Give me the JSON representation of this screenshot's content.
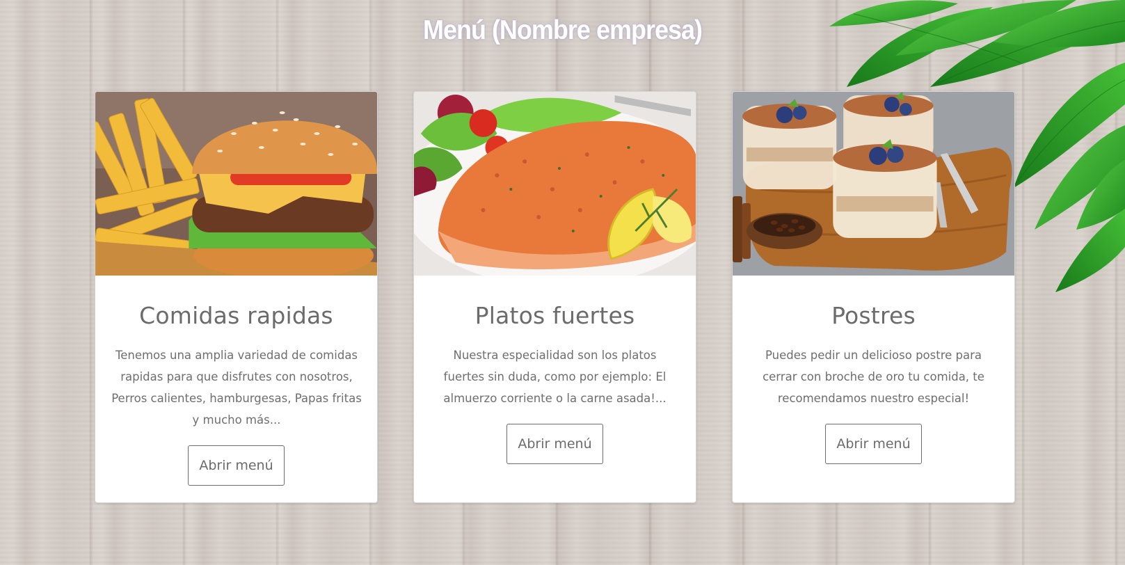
{
  "header": {
    "title": "Menú (Nombre empresa)"
  },
  "cards": [
    {
      "image_alt": "hamburger-and-fries",
      "title": "Comidas rapidas",
      "text": "Tenemos una amplia variedad de comidas rapidas para que disfrutes con nosotros, Perros calientes, hamburgesas, Papas fritas y mucho más...",
      "button_label": "Abrir menú"
    },
    {
      "image_alt": "salmon-fillet-with-salad",
      "title": "Platos fuertes",
      "text": "Nuestra especialidad son los platos fuertes sin duda, como por ejemplo: El almuerzo corriente o la carne asada!...",
      "button_label": "Abrir menú"
    },
    {
      "image_alt": "tiramisu-cups-with-blueberries",
      "title": "Postres",
      "text": "Puedes pedir un delicioso postre para cerrar con broche de oro tu comida, te recomendamos nuestro especial!",
      "button_label": "Abrir menú"
    }
  ],
  "colors": {
    "card_text": "#6e6e6e",
    "button_border": "#6b6b6b",
    "background": "#d8d1ca",
    "leaves": "#2fa52c"
  }
}
